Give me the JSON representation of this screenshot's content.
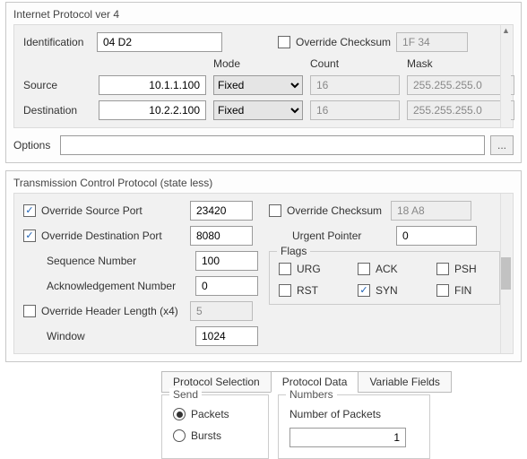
{
  "ipv4": {
    "title": "Internet Protocol ver 4",
    "identification_label": "Identification",
    "identification_value": "04 D2",
    "override_checksum_label": "Override Checksum",
    "override_checksum_checked": false,
    "checksum_value": "1F 34",
    "headers": {
      "mode": "Mode",
      "count": "Count",
      "mask": "Mask"
    },
    "source_label": "Source",
    "source_value": "10.1.1.100",
    "source_mode": "Fixed",
    "source_count": "16",
    "source_mask": "255.255.255.0",
    "dest_label": "Destination",
    "dest_value": "10.2.2.100",
    "dest_mode": "Fixed",
    "dest_count": "16",
    "dest_mask": "255.255.255.0",
    "options_label": "Options",
    "options_value": "",
    "ellipsis": "..."
  },
  "tcp": {
    "title": "Transmission Control Protocol (state less)",
    "override_src_port_label": "Override Source Port",
    "override_src_port_checked": true,
    "src_port_value": "23420",
    "override_dst_port_label": "Override Destination Port",
    "override_dst_port_checked": true,
    "dst_port_value": "8080",
    "seq_label": "Sequence Number",
    "seq_value": "100",
    "ack_label": "Acknowledgement Number",
    "ack_value": "0",
    "hdr_len_label": "Override Header Length (x4)",
    "hdr_len_checked": false,
    "hdr_len_value": "5",
    "window_label": "Window",
    "window_value": "1024",
    "override_checksum_label": "Override Checksum",
    "override_checksum_checked": false,
    "checksum_value": "18 A8",
    "urgent_label": "Urgent Pointer",
    "urgent_value": "0",
    "flags_label": "Flags",
    "flags": {
      "URG": {
        "label": "URG",
        "checked": false
      },
      "ACK": {
        "label": "ACK",
        "checked": false
      },
      "PSH": {
        "label": "PSH",
        "checked": false
      },
      "RST": {
        "label": "RST",
        "checked": false
      },
      "SYN": {
        "label": "SYN",
        "checked": true
      },
      "FIN": {
        "label": "FIN",
        "checked": false
      }
    }
  },
  "tabs": {
    "protocol_selection": "Protocol Selection",
    "protocol_data": "Protocol Data",
    "variable_fields": "Variable Fields"
  },
  "send": {
    "legend": "Send",
    "packets_label": "Packets",
    "bursts_label": "Bursts",
    "selected": "packets"
  },
  "numbers": {
    "legend": "Numbers",
    "num_packets_label": "Number of Packets",
    "num_packets_value": "1"
  }
}
